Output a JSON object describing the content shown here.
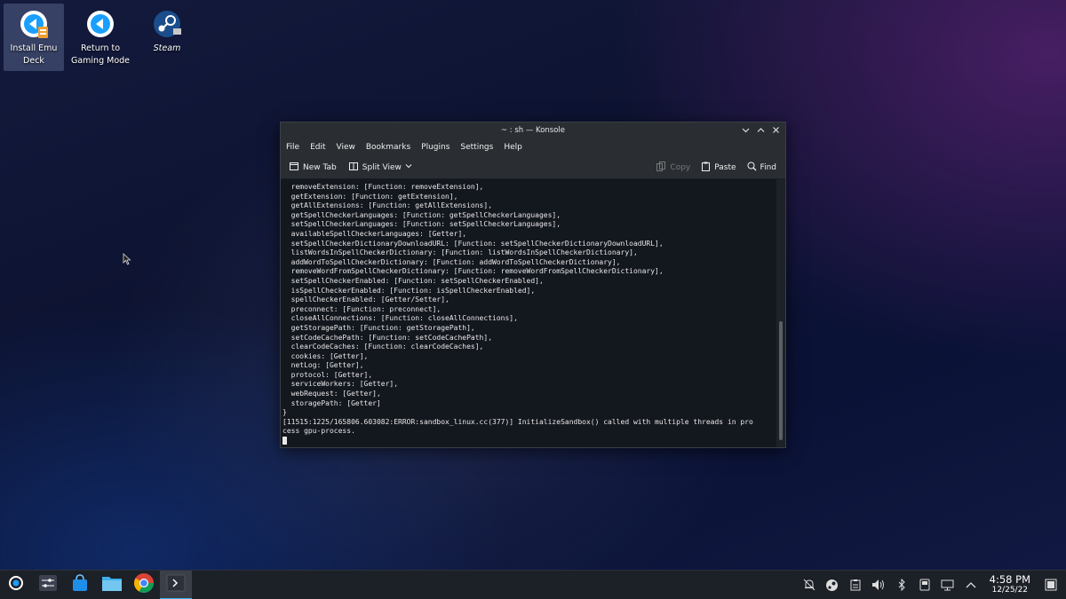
{
  "desktop": {
    "icons": [
      {
        "label": "Install Emu Deck"
      },
      {
        "label": "Return to Gaming Mode"
      },
      {
        "label": "Steam"
      }
    ]
  },
  "window": {
    "title": "~ : sh — Konsole",
    "menu": [
      "File",
      "Edit",
      "View",
      "Bookmarks",
      "Plugins",
      "Settings",
      "Help"
    ],
    "toolbar": {
      "new_tab": "New Tab",
      "split_view": "Split View",
      "copy": "Copy",
      "paste": "Paste",
      "find": "Find"
    },
    "terminal_lines": [
      "  removeExtension: [Function: removeExtension],",
      "  getExtension: [Function: getExtension],",
      "  getAllExtensions: [Function: getAllExtensions],",
      "  getSpellCheckerLanguages: [Function: getSpellCheckerLanguages],",
      "  setSpellCheckerLanguages: [Function: setSpellCheckerLanguages],",
      "  availableSpellCheckerLanguages: [Getter],",
      "  setSpellCheckerDictionaryDownloadURL: [Function: setSpellCheckerDictionaryDownloadURL],",
      "  listWordsInSpellCheckerDictionary: [Function: listWordsInSpellCheckerDictionary],",
      "  addWordToSpellCheckerDictionary: [Function: addWordToSpellCheckerDictionary],",
      "  removeWordFromSpellCheckerDictionary: [Function: removeWordFromSpellCheckerDictionary],",
      "  setSpellCheckerEnabled: [Function: setSpellCheckerEnabled],",
      "  isSpellCheckerEnabled: [Function: isSpellCheckerEnabled],",
      "  spellCheckerEnabled: [Getter/Setter],",
      "  preconnect: [Function: preconnect],",
      "  closeAllConnections: [Function: closeAllConnections],",
      "  getStoragePath: [Function: getStoragePath],",
      "  setCodeCachePath: [Function: setCodeCachePath],",
      "  clearCodeCaches: [Function: clearCodeCaches],",
      "  cookies: [Getter],",
      "  netLog: [Getter],",
      "  protocol: [Getter],",
      "  serviceWorkers: [Getter],",
      "  webRequest: [Getter],",
      "  storagePath: [Getter]",
      "}",
      "[11515:1225/165806.603082:ERROR:sandbox_linux.cc(377)] InitializeSandbox() called with multiple threads in pro",
      "cess gpu-process."
    ]
  },
  "taskbar": {
    "clock": {
      "time": "4:58 PM",
      "date": "12/25/22"
    }
  }
}
